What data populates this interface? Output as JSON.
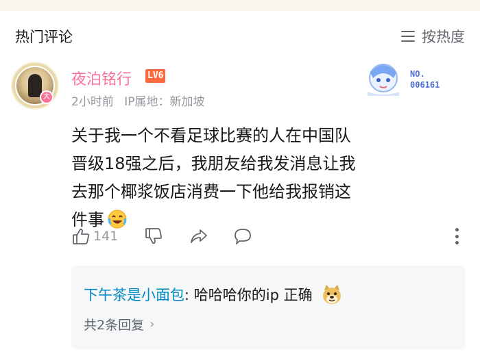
{
  "section": {
    "title": "热门评论",
    "sort_label": "按热度"
  },
  "comment": {
    "username": "夜泊铭行",
    "level": "LV6",
    "avatar_badge": "大",
    "time": "2小时前",
    "ip_location": "IP属地：新加坡",
    "content": "关于我一个不看足球比赛的人在中国队晋级18强之后，我朋友给我发消息让我去那个椰浆饭店消费一下他给我报销这件事",
    "content_emoji": "crying-laughing-emoji",
    "like_count": "141",
    "decoration_no_label": "NO.",
    "decoration_no_value": "006161"
  },
  "reply": {
    "username": "下午茶是小面包",
    "separator": ":",
    "text": "哈哈哈你的ip 正确",
    "emoji": "doge-emoji",
    "more_label": "共2条回复"
  },
  "colors": {
    "username": "#fb7299",
    "level_badge": "#ff6a3d",
    "reply_user": "#008ac5",
    "meta": "#9499a0"
  }
}
